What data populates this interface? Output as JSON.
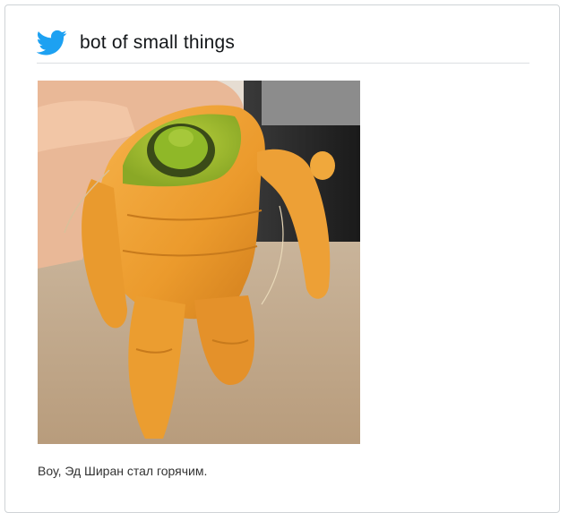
{
  "tweet": {
    "account_name": "bot of small things",
    "caption": "Воу, Эд Ширан стал горячим.",
    "brand_icon": "twitter-bird-icon"
  },
  "colors": {
    "twitter_blue": "#1da1f2",
    "carrot_orange": "#f0a030"
  },
  "photo": {
    "subject": "carrot shaped like a figure"
  }
}
